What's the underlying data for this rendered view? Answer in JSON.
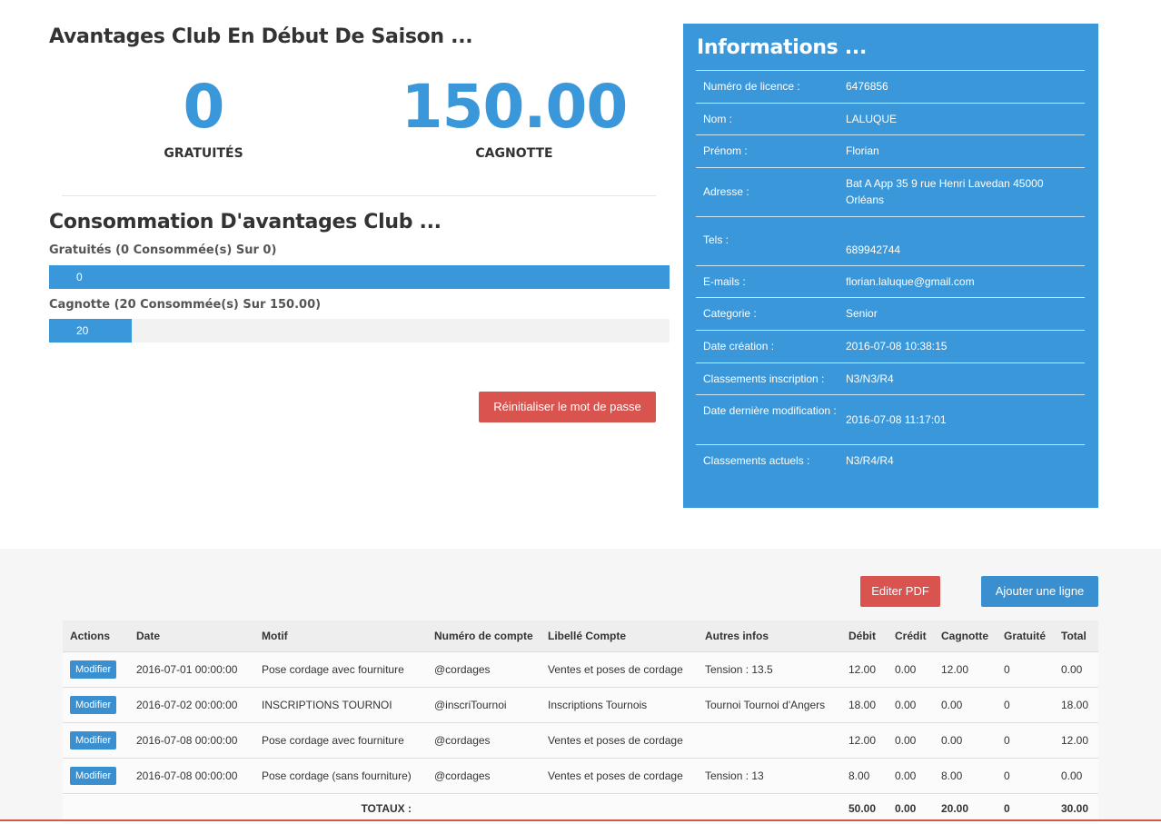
{
  "advantages": {
    "title": "Avantages Club En Début De Saison ...",
    "free_value": "0",
    "free_label": "GRATUITÉS",
    "kitty_value": "150.00",
    "kitty_label": "CAGNOTTE"
  },
  "consumption": {
    "title": "Consommation D'avantages Club ...",
    "free_label": "Gratuités (0 Consommée(s) Sur 0)",
    "free_value": "0",
    "free_fraction": 1.0,
    "kitty_label": "Cagnotte (20 Consommée(s) Sur 150.00)",
    "kitty_value": "20",
    "kitty_fraction": 0.1333
  },
  "reset_password_label": "Réinitialiser le mot de passe",
  "info": {
    "title": "Informations ...",
    "rows": [
      {
        "key": "Numéro de licence :",
        "value": "6476856"
      },
      {
        "key": "Nom :",
        "value": "LALUQUE"
      },
      {
        "key": "Prénom :",
        "value": "Florian"
      },
      {
        "key": "Adresse :",
        "value": "Bat A App 35 9 rue Henri Lavedan 45000 Orléans"
      },
      {
        "key": "Tels :",
        "value": "689942744"
      },
      {
        "key": "E-mails :",
        "value": "florian.laluque@gmail.com"
      },
      {
        "key": "Categorie :",
        "value": "Senior"
      },
      {
        "key": "Date création :",
        "value": "2016-07-08 10:38:15"
      },
      {
        "key": "Classements inscription :",
        "value": "N3/N3/R4"
      },
      {
        "key": "Date dernière modification :",
        "value": "2016-07-08 11:17:01"
      },
      {
        "key": "Classements actuels :",
        "value": "N3/R4/R4"
      }
    ]
  },
  "actions": {
    "edit_pdf": "Editer PDF",
    "add_line": "Ajouter une ligne"
  },
  "table": {
    "headers": [
      "Actions",
      "Date",
      "Motif",
      "Numéro de compte",
      "Libellé Compte",
      "Autres infos",
      "Débit",
      "Crédit",
      "Cagnotte",
      "Gratuité",
      "Total"
    ],
    "modify_label": "Modifier",
    "rows": [
      {
        "date": "2016-07-01 00:00:00",
        "motif": "Pose cordage avec fourniture",
        "account": "@cordages",
        "account_label": "Ventes et poses de cordage",
        "other": "Tension : 13.5",
        "debit": "12.00",
        "credit": "0.00",
        "kitty": "12.00",
        "free": "0",
        "total": "0.00"
      },
      {
        "date": "2016-07-02 00:00:00",
        "motif": "INSCRIPTIONS TOURNOI",
        "account": "@inscriTournoi",
        "account_label": "Inscriptions Tournois",
        "other": "Tournoi Tournoi d'Angers",
        "debit": "18.00",
        "credit": "0.00",
        "kitty": "0.00",
        "free": "0",
        "total": "18.00"
      },
      {
        "date": "2016-07-08 00:00:00",
        "motif": "Pose cordage avec fourniture",
        "account": "@cordages",
        "account_label": "Ventes et poses de cordage",
        "other": "",
        "debit": "12.00",
        "credit": "0.00",
        "kitty": "0.00",
        "free": "0",
        "total": "12.00"
      },
      {
        "date": "2016-07-08 00:00:00",
        "motif": "Pose cordage (sans fourniture)",
        "account": "@cordages",
        "account_label": "Ventes et poses de cordage",
        "other": "Tension : 13",
        "debit": "8.00",
        "credit": "0.00",
        "kitty": "8.00",
        "free": "0",
        "total": "0.00"
      }
    ],
    "totals": {
      "label": "TOTAUX :",
      "debit": "50.00",
      "credit": "0.00",
      "kitty": "20.00",
      "free": "0",
      "total": "30.00"
    }
  },
  "colors": {
    "accent": "#3a97d9",
    "danger": "#d9534f"
  }
}
